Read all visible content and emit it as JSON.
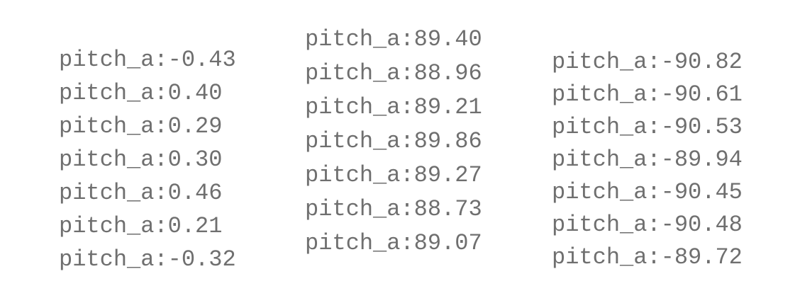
{
  "columns": [
    {
      "lines": [
        "pitch_a:-0.43",
        "pitch_a:0.40",
        "pitch_a:0.29",
        "pitch_a:0.30",
        "pitch_a:0.46",
        "pitch_a:0.21",
        "pitch_a:-0.32"
      ]
    },
    {
      "lines": [
        "pitch_a:89.40",
        "pitch_a:88.96",
        "pitch_a:89.21",
        "pitch_a:89.86",
        "pitch_a:89.27",
        "pitch_a:88.73",
        "pitch_a:89.07"
      ]
    },
    {
      "lines": [
        "pitch_a:-90.82",
        "pitch_a:-90.61",
        "pitch_a:-90.53",
        "pitch_a:-89.94",
        "pitch_a:-90.45",
        "pitch_a:-90.48",
        "pitch_a:-89.72"
      ]
    }
  ]
}
